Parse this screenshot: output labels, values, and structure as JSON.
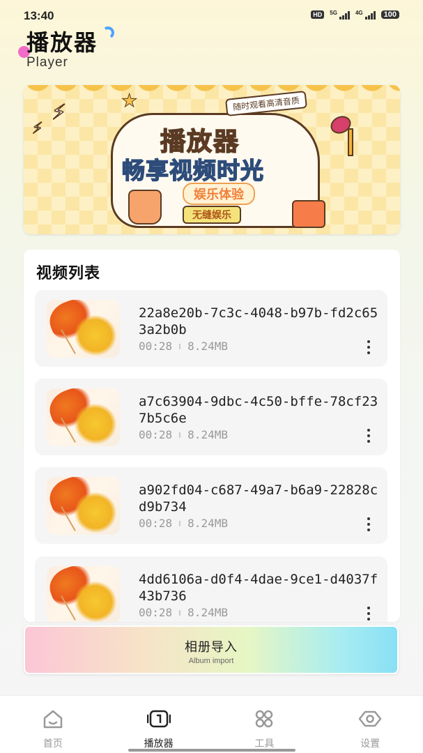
{
  "status_bar": {
    "time": "13:40",
    "hd": "HD",
    "net1": "5G",
    "net2": "4G",
    "battery": "100"
  },
  "header": {
    "title": "播放器",
    "subtitle": "Player"
  },
  "banner": {
    "tag": "随时观看高清音质",
    "title": "播放器",
    "slogan": "畅享视频时光",
    "sub": "娱乐体验",
    "chip": "无缝娱乐"
  },
  "video_list": {
    "heading": "视频列表",
    "items": [
      {
        "title": "22a8e20b-7c3c-4048-b97b-fd2c653a2b0b",
        "duration": "00:28",
        "size": "8.24MB"
      },
      {
        "title": "a7c63904-9dbc-4c50-bffe-78cf237b5c6e",
        "duration": "00:28",
        "size": "8.24MB"
      },
      {
        "title": "a902fd04-c687-49a7-b6a9-22828cd9b734",
        "duration": "00:28",
        "size": "8.24MB"
      },
      {
        "title": "4dd6106a-d0f4-4dae-9ce1-d4037f43b736",
        "duration": "00:28",
        "size": "8.24MB"
      }
    ]
  },
  "import_button": {
    "label": "相册导入",
    "sublabel": "Album import"
  },
  "tabs": [
    {
      "label": "首页",
      "icon": "home-icon",
      "active": false
    },
    {
      "label": "播放器",
      "icon": "player-icon",
      "active": true
    },
    {
      "label": "工具",
      "icon": "grid-icon",
      "active": false
    },
    {
      "label": "设置",
      "icon": "settings-eye-icon",
      "active": false
    }
  ],
  "colors": {
    "accent_pink": "#f26bc8",
    "accent_blue": "#4da3ff",
    "text_primary": "#222222",
    "text_muted": "#999999"
  }
}
